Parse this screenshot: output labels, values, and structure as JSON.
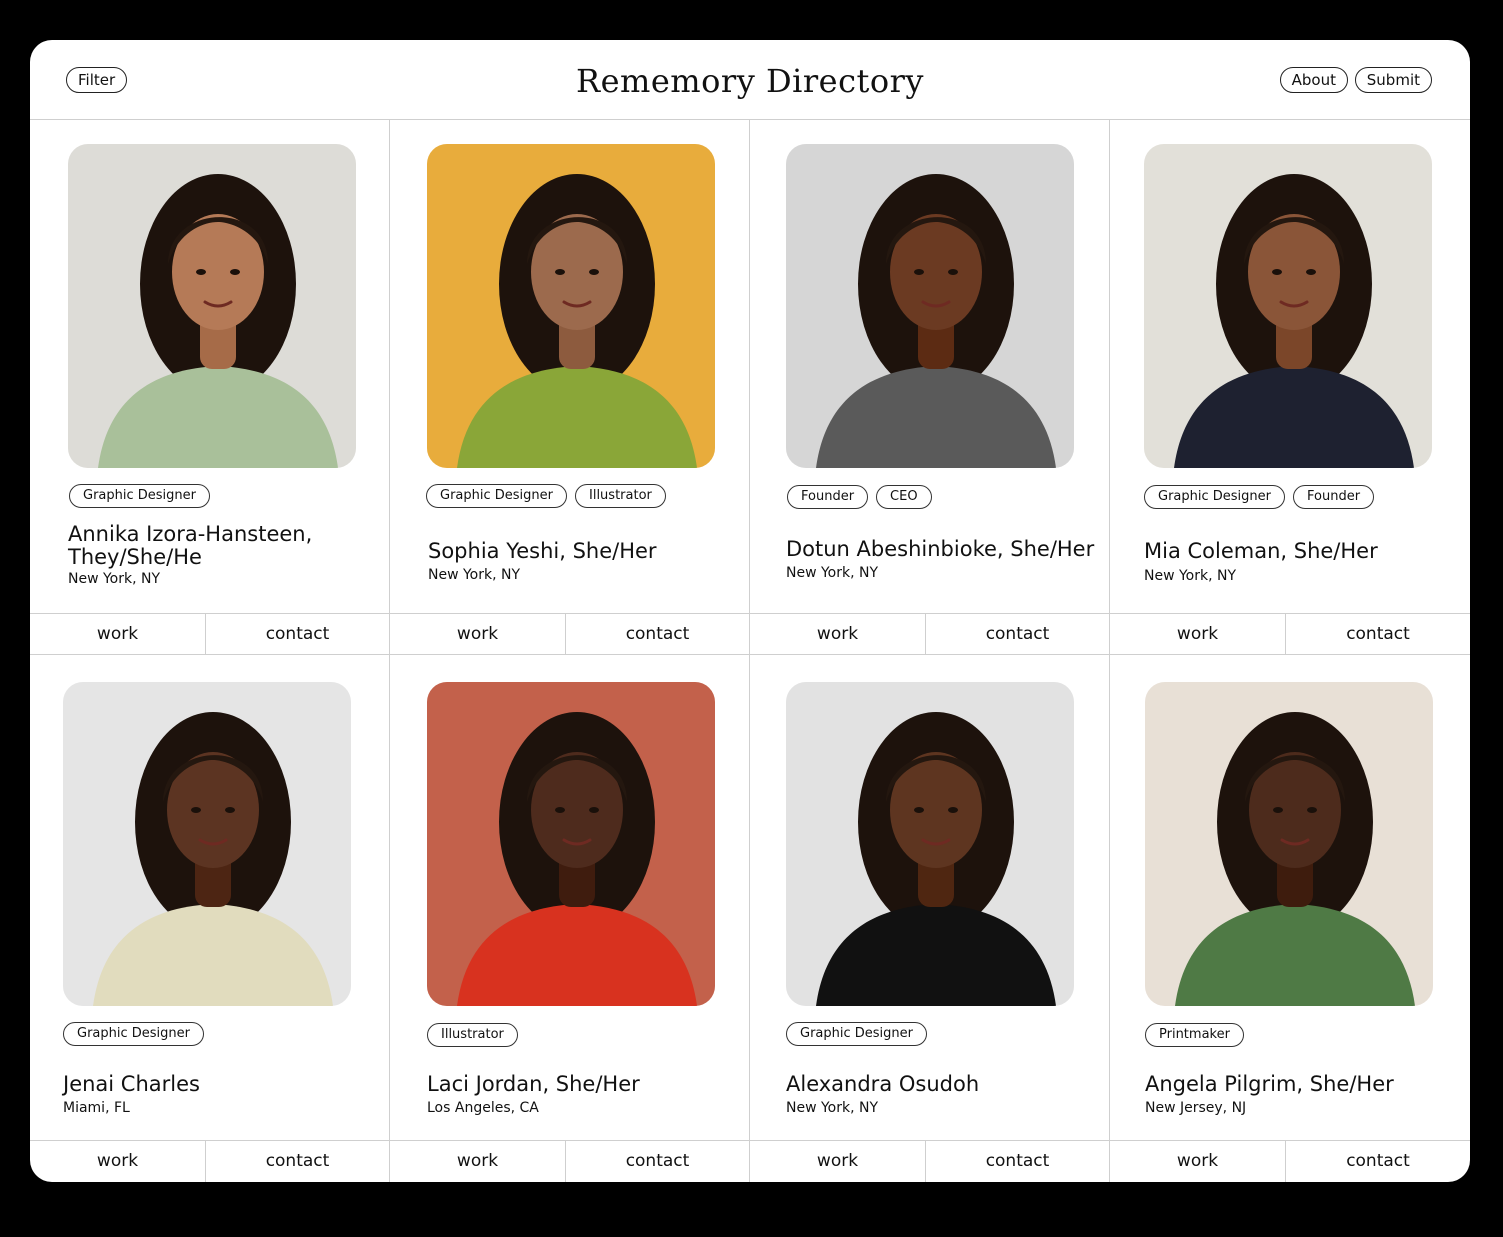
{
  "header": {
    "title": "Rememory Directory",
    "filter_label": "Filter",
    "about_label": "About",
    "submit_label": "Submit"
  },
  "colors": {
    "background": "#000000",
    "panel": "#ffffff",
    "ink": "#111111",
    "divider": "#cfcfcf"
  },
  "actions": {
    "work_label": "work",
    "contact_label": "contact"
  },
  "profiles": [
    {
      "name": "Annika Izora-Hansteen, They/She/He",
      "location": "New York, NY",
      "tags": [
        "Graphic Designer"
      ],
      "photo_bg": "#e4e2de",
      "photo_accent": "#a9c09a",
      "skin": "#b57a57"
    },
    {
      "name": "Sophia Yeshi, She/Her",
      "location": "New York, NY",
      "tags": [
        "Graphic Designer",
        "Illustrator"
      ],
      "photo_bg": "#efb343",
      "photo_accent": "#8aa638",
      "skin": "#9c6a4d"
    },
    {
      "name": "Dotun Abeshinbioke, She/Her",
      "location": "New York, NY",
      "tags": [
        "Founder",
        "CEO"
      ],
      "photo_bg": "#dcdcdc",
      "photo_accent": "#5a5a5a",
      "skin": "#6b3a22"
    },
    {
      "name": "Mia Coleman, She/Her",
      "location": "New York, NY",
      "tags": [
        "Graphic Designer",
        "Founder"
      ],
      "photo_bg": "#e9e6df",
      "photo_accent": "#1e2130",
      "skin": "#8a5538"
    },
    {
      "name": "Jenai Charles",
      "location": "Miami, FL",
      "tags": [
        "Graphic Designer"
      ],
      "photo_bg": "#ececec",
      "photo_accent": "#e1dcbe",
      "skin": "#5c3422"
    },
    {
      "name": "Laci Jordan, She/Her",
      "location": "Los Angeles, CA",
      "tags": [
        "Illustrator"
      ],
      "photo_bg": "#c96852",
      "photo_accent": "#d8321f",
      "skin": "#4e2b1d"
    },
    {
      "name": "Alexandra Osudoh",
      "location": "New York, NY",
      "tags": [
        "Graphic Designer"
      ],
      "photo_bg": "#e8e8e8",
      "photo_accent": "#111111",
      "skin": "#5e3520"
    },
    {
      "name": "Angela Pilgrim, She/Her",
      "location": "New Jersey, NJ",
      "tags": [
        "Printmaker"
      ],
      "photo_bg": "#efe6dc",
      "photo_accent": "#4f7a45",
      "skin": "#4d2b1c"
    }
  ]
}
